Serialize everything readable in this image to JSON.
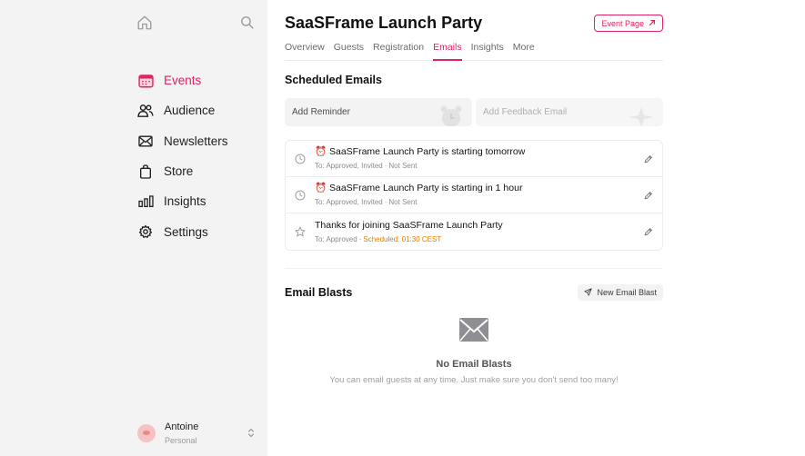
{
  "sidebar": {
    "nav": [
      {
        "label": "Events",
        "icon": "calendar-icon"
      },
      {
        "label": "Audience",
        "icon": "users-icon"
      },
      {
        "label": "Newsletters",
        "icon": "mail-icon"
      },
      {
        "label": "Store",
        "icon": "shopping-bag-icon"
      },
      {
        "label": "Insights",
        "icon": "bar-chart-icon"
      },
      {
        "label": "Settings",
        "icon": "gear-icon"
      }
    ],
    "user": {
      "name": "Antoine",
      "account": "Personal"
    }
  },
  "header": {
    "title": "SaaSFrame Launch Party",
    "event_page_label": "Event Page"
  },
  "tabs": [
    "Overview",
    "Guests",
    "Registration",
    "Emails",
    "Insights",
    "More"
  ],
  "active_tab": "Emails",
  "scheduled": {
    "title": "Scheduled Emails",
    "quick_actions": [
      "Add Reminder",
      "Add Feedback Email"
    ],
    "emails": [
      {
        "emoji": "⏰",
        "title": "SaaSFrame Launch Party is starting tomorrow",
        "to": "To: Approved, Invited",
        "status": "Not Sent",
        "icon": "clock-icon"
      },
      {
        "emoji": "⏰",
        "title": "SaaSFrame Launch Party is starting in 1 hour",
        "to": "To: Approved, Invited",
        "status": "Not Sent",
        "icon": "clock-icon"
      },
      {
        "emoji": "",
        "title": "Thanks for joining SaaSFrame Launch Party",
        "to": "To: Approved",
        "status": "Scheduled: 01:30 CEST",
        "icon": "star-icon"
      }
    ]
  },
  "blasts": {
    "title": "Email Blasts",
    "new_label": "New Email Blast",
    "empty_title": "No Email Blasts",
    "empty_sub": "You can email guests at any time. Just make sure you don't send too many!"
  },
  "colors": {
    "accent": "#e0245e",
    "scheduled": "#e67e00",
    "sidebar_bg": "#f3f3f4"
  }
}
